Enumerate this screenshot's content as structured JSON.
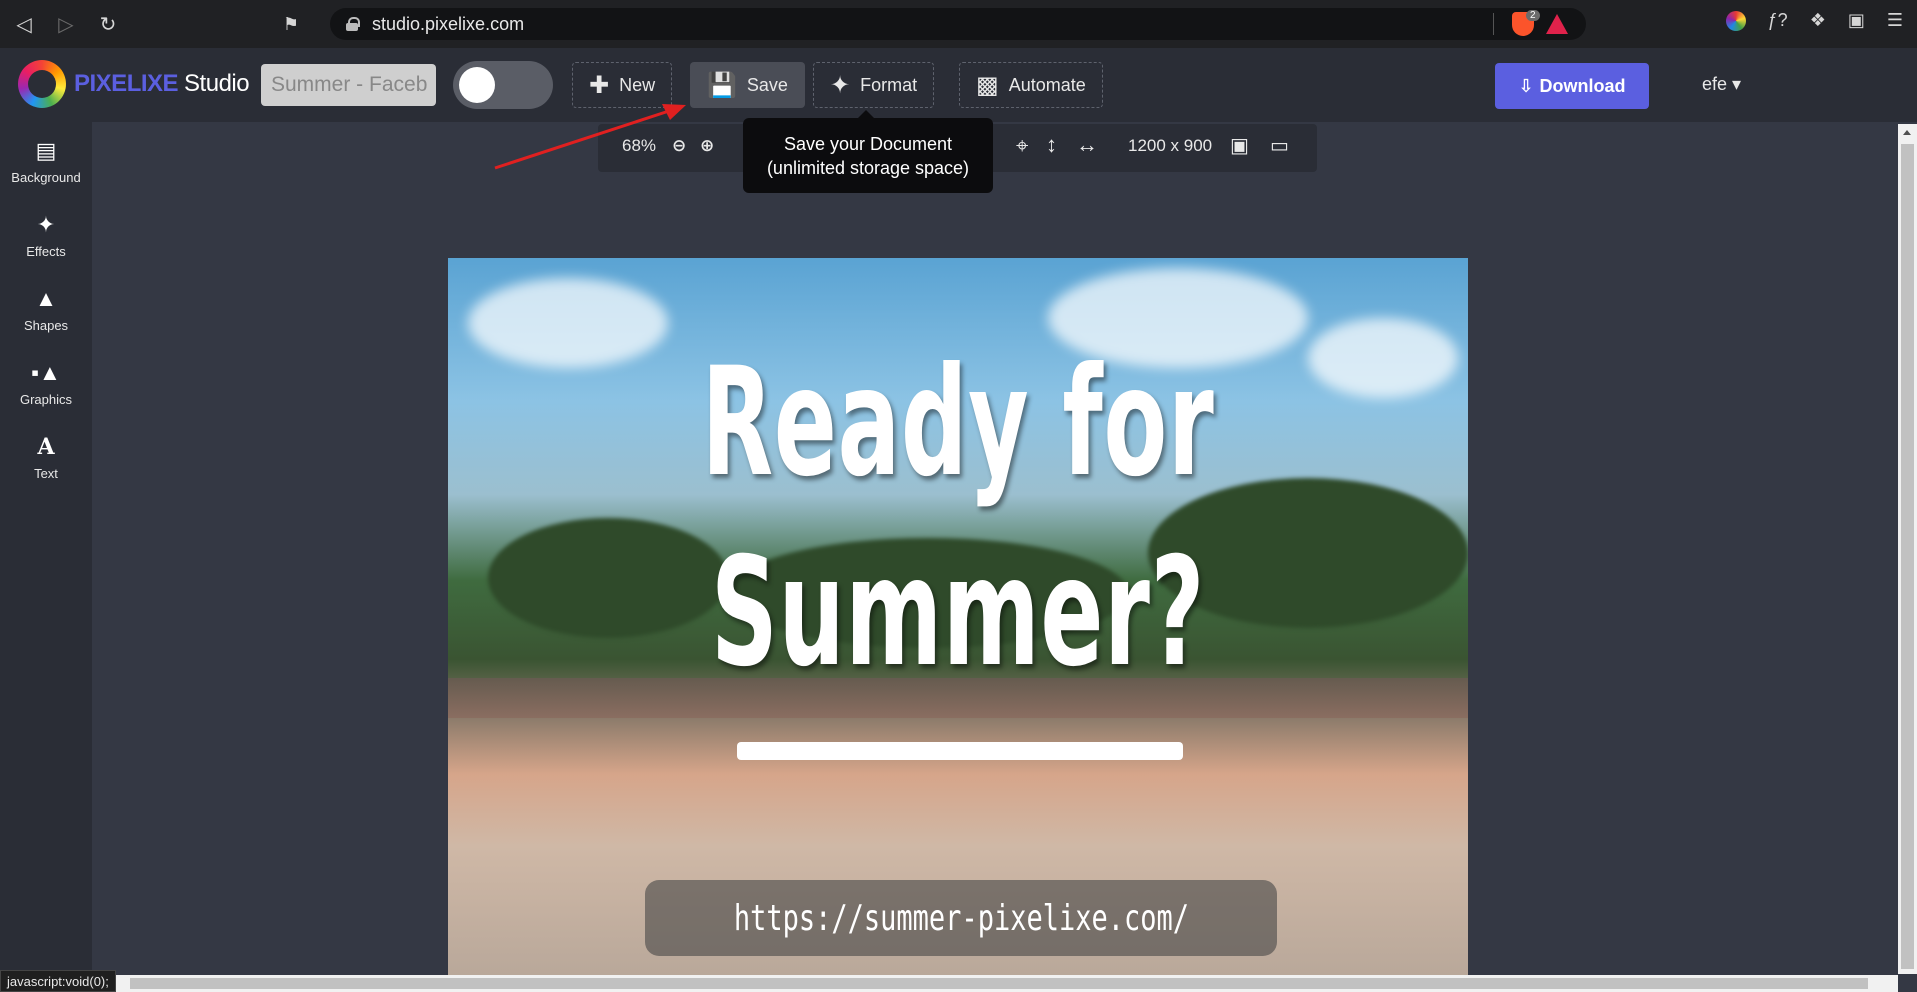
{
  "browser": {
    "url": "studio.pixelixe.com",
    "brave_count": "2"
  },
  "header": {
    "brand_name": "PIXELIXE",
    "brand_suffix": "Studio",
    "doc_name_value": "Summer - Faceb",
    "new_label": "New",
    "save_label": "Save",
    "format_label": "Format",
    "automate_label": "Automate",
    "download_label": "Download",
    "user_label": "efe"
  },
  "sidebar": {
    "items": [
      {
        "label": "Background",
        "icon": "image-icon"
      },
      {
        "label": "Effects",
        "icon": "magic-wand-icon"
      },
      {
        "label": "Shapes",
        "icon": "shapes-icon"
      },
      {
        "label": "Graphics",
        "icon": "graphics-icon"
      },
      {
        "label": "Text",
        "icon": "text-icon"
      }
    ]
  },
  "toolbar": {
    "zoom": "68%",
    "dimensions": "1200 x 900"
  },
  "tooltip": {
    "line1": "Save your Document",
    "line2": "(unlimited storage space)"
  },
  "canvas": {
    "headline_line1": "Ready for",
    "headline_line2": "Summer?",
    "url_text": "https://summer-pixelixe.com/"
  },
  "status_bar": {
    "text": "javascript:void(0);"
  },
  "colors": {
    "accent": "#5b5fe0",
    "header_bg": "#2a2d36",
    "workspace_bg": "#343844",
    "annotation_arrow": "#e02020"
  }
}
